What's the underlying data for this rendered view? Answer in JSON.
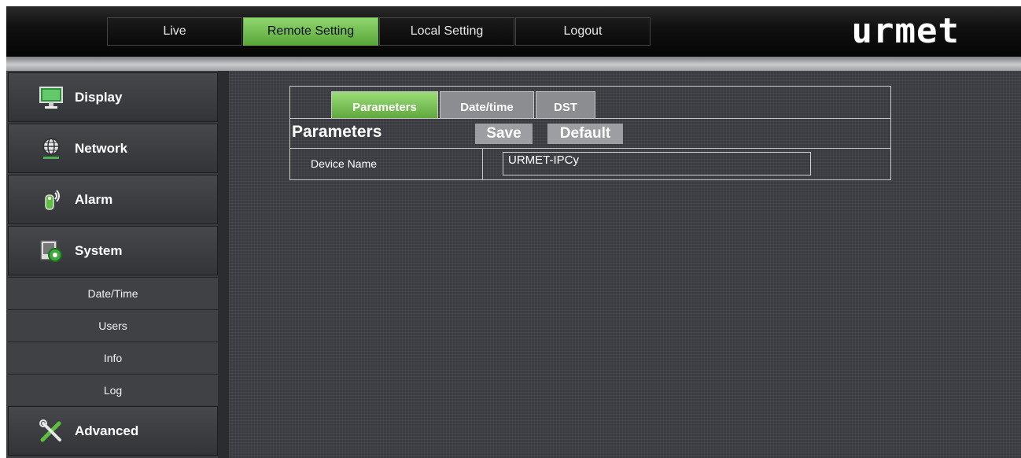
{
  "topnav": {
    "items": [
      {
        "label": "Live",
        "active": false
      },
      {
        "label": "Remote Setting",
        "active": true
      },
      {
        "label": "Local Setting",
        "active": false
      },
      {
        "label": "Logout",
        "active": false
      }
    ],
    "logo": "urmet"
  },
  "sidebar": {
    "display_label": "Display",
    "network_label": "Network",
    "alarm_label": "Alarm",
    "system_label": "System",
    "system_items": [
      "Date/Time",
      "Users",
      "Info",
      "Log"
    ],
    "advanced_label": "Advanced"
  },
  "panel": {
    "tabs": [
      "Parameters",
      "Date/time",
      "DST"
    ],
    "active_tab": "Parameters",
    "title": "Parameters",
    "save_label": "Save",
    "default_label": "Default",
    "device_name_label": "Device Name",
    "device_name_value": "URMET-IPCy"
  },
  "colors": {
    "accent_green": "#6ab04a",
    "background": "#3a3c41"
  }
}
